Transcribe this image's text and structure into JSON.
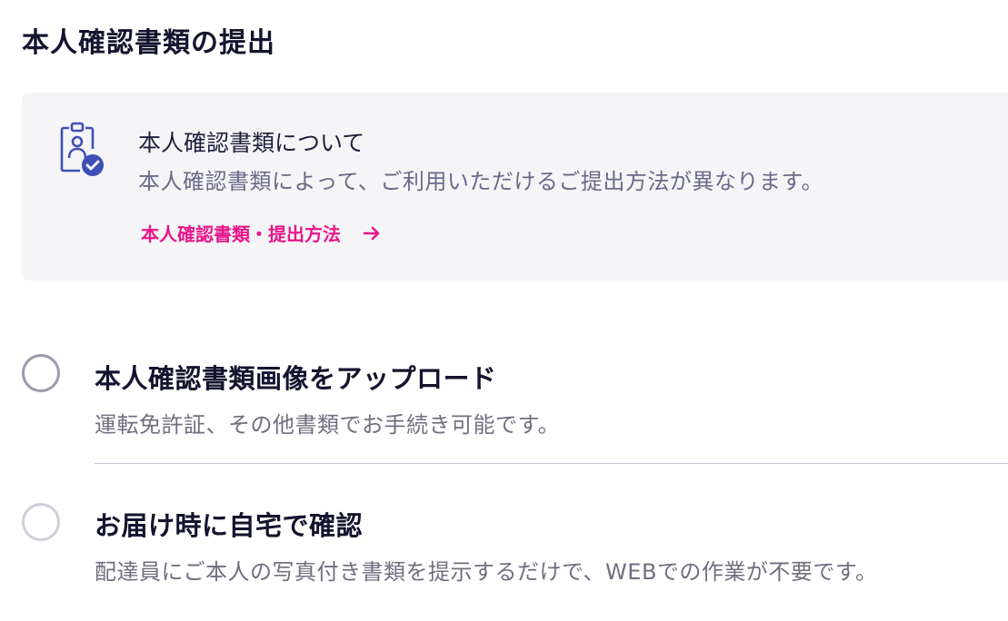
{
  "page": {
    "title": "本人確認書類の提出"
  },
  "info_box": {
    "icon": "id-badge-check-icon",
    "title": "本人確認書類について",
    "description": "本人確認書類によって、ご利用いただけるご提出方法が異なります。",
    "link_label": "本人確認書類・提出方法",
    "link_icon": "arrow-right-icon",
    "link_color": "#e8168a"
  },
  "options": [
    {
      "title": "本人確認書類画像をアップロード",
      "description": "運転免許証、その他書類でお手続き可能です。",
      "selected": false
    },
    {
      "title": "お届け時に自宅で確認",
      "description": "配達員にご本人の写真付き書類を提示するだけで、WEBでの作業が不要です。",
      "selected": false
    }
  ],
  "colors": {
    "accent": "#e8168a",
    "icon_blue": "#3f4fb5",
    "radio_border_primary": "#9a9aae",
    "radio_border_secondary": "#cfcfda"
  }
}
